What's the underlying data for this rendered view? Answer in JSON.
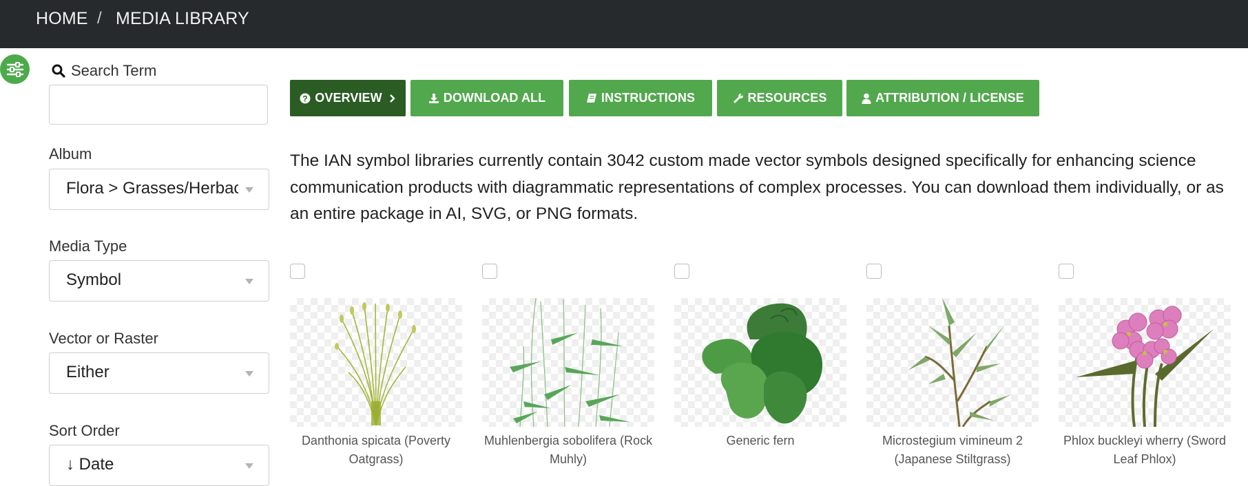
{
  "breadcrumb": {
    "home": "HOME",
    "separator": "/",
    "current": "MEDIA LIBRARY"
  },
  "filters_toggle_icon": "sliders-icon",
  "sidebar": {
    "search": {
      "label": "Search Term",
      "icon": "search-icon",
      "value": ""
    },
    "album": {
      "label": "Album",
      "value": "Flora > Grasses/Herbaceous"
    },
    "media_type": {
      "label": "Media Type",
      "value": "Symbol"
    },
    "vector_raster": {
      "label": "Vector or Raster",
      "value": "Either"
    },
    "sort_order": {
      "label": "Sort Order",
      "value": "↓ Date"
    }
  },
  "toolbar": [
    {
      "label": "OVERVIEW",
      "icon": "question-circle-icon",
      "active": true
    },
    {
      "label": "DOWNLOAD ALL",
      "icon": "download-icon",
      "active": false
    },
    {
      "label": "INSTRUCTIONS",
      "icon": "book-icon",
      "active": false
    },
    {
      "label": "RESOURCES",
      "icon": "wrench-icon",
      "active": false
    },
    {
      "label": "ATTRIBUTION / LICENSE",
      "icon": "user-icon",
      "active": false
    }
  ],
  "intro_text": "The IAN symbol libraries currently contain 3042 custom made vector symbols designed specifically for enhancing science communication products with diagrammatic representations of complex processes. You can download them individually, or as an entire package in AI, SVG, or PNG formats.",
  "symbols": [
    {
      "caption": "Danthonia spicata (Poverty Oatgrass)",
      "checked": false
    },
    {
      "caption": "Muhlenbergia sobolifera (Rock Muhly)",
      "checked": false
    },
    {
      "caption": "Generic fern",
      "checked": false
    },
    {
      "caption": "Microstegium vimineum 2 (Japanese Stiltgrass)",
      "checked": false
    },
    {
      "caption": "Phlox buckleyi wherry (Sword Leaf Phlox)",
      "checked": false
    }
  ],
  "colors": {
    "topbar": "#262a2c",
    "button": "#52a84d",
    "button_active": "#2a5c23",
    "accent": "#4caa4a"
  }
}
